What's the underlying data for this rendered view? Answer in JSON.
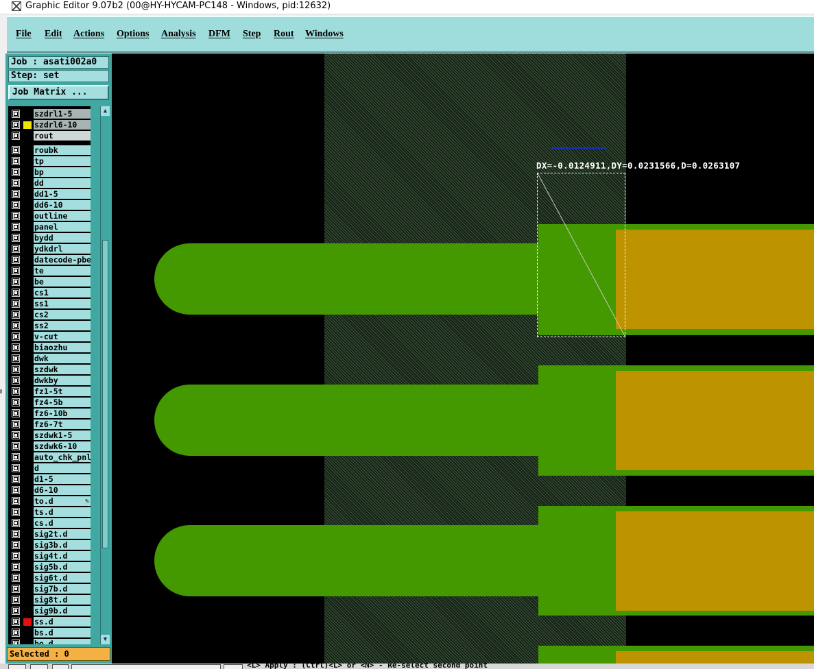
{
  "window": {
    "title": "Graphic Editor 9.07b2 (00@HY-HYCAM-PC148 - Windows, pid:12632)"
  },
  "menu": [
    "File",
    "Edit",
    "Actions",
    "Options",
    "Analysis",
    "DFM",
    "Step",
    "Rout",
    "Windows"
  ],
  "job": {
    "job_label": "Job : asati002a0",
    "step_label": "Step: set",
    "matrix_button": "Job Matrix ..."
  },
  "layers_top": [
    {
      "name": "szdrl1-5",
      "swatch": "",
      "style": "gray"
    },
    {
      "name": "szdrl6-10",
      "swatch": "#f2e200",
      "style": "gray"
    },
    {
      "name": "rout",
      "swatch": "",
      "style": "active"
    }
  ],
  "layers": [
    {
      "name": "roubk",
      "swatch": ""
    },
    {
      "name": "tp",
      "swatch": ""
    },
    {
      "name": "bp",
      "swatch": ""
    },
    {
      "name": "dd",
      "swatch": ""
    },
    {
      "name": "dd1-5",
      "swatch": ""
    },
    {
      "name": "dd6-10",
      "swatch": ""
    },
    {
      "name": "outline",
      "swatch": ""
    },
    {
      "name": "panel",
      "swatch": ""
    },
    {
      "name": "bydd",
      "swatch": ""
    },
    {
      "name": "ydkdrl",
      "swatch": ""
    },
    {
      "name": "datecode-pbe",
      "swatch": ""
    },
    {
      "name": "te",
      "swatch": ""
    },
    {
      "name": "be",
      "swatch": ""
    },
    {
      "name": "cs1",
      "swatch": ""
    },
    {
      "name": "ss1",
      "swatch": ""
    },
    {
      "name": "cs2",
      "swatch": ""
    },
    {
      "name": "ss2",
      "swatch": ""
    },
    {
      "name": "v-cut",
      "swatch": ""
    },
    {
      "name": "biaozhu",
      "swatch": ""
    },
    {
      "name": "dwk",
      "swatch": ""
    },
    {
      "name": "szdwk",
      "swatch": ""
    },
    {
      "name": "dwkby",
      "swatch": ""
    },
    {
      "name": "fz1-5t",
      "swatch": ""
    },
    {
      "name": "fz4-5b",
      "swatch": ""
    },
    {
      "name": "fz6-10b",
      "swatch": ""
    },
    {
      "name": "fz6-7t",
      "swatch": ""
    },
    {
      "name": "szdwk1-5",
      "swatch": ""
    },
    {
      "name": "szdwk6-10",
      "swatch": ""
    },
    {
      "name": "auto_chk_pnl",
      "swatch": ""
    },
    {
      "name": "d",
      "swatch": ""
    },
    {
      "name": "d1-5",
      "swatch": ""
    },
    {
      "name": "d6-10",
      "swatch": ""
    },
    {
      "name": "to.d",
      "swatch": "",
      "pointer": true
    },
    {
      "name": "ts.d",
      "swatch": ""
    },
    {
      "name": "cs.d",
      "swatch": ""
    },
    {
      "name": "sig2t.d",
      "swatch": ""
    },
    {
      "name": "sig3b.d",
      "swatch": ""
    },
    {
      "name": "sig4t.d",
      "swatch": ""
    },
    {
      "name": "sig5b.d",
      "swatch": ""
    },
    {
      "name": "sig6t.d",
      "swatch": ""
    },
    {
      "name": "sig7b.d",
      "swatch": ""
    },
    {
      "name": "sig8t.d",
      "swatch": ""
    },
    {
      "name": "sig9b.d",
      "swatch": ""
    },
    {
      "name": "ss.d",
      "swatch": "#e41010"
    },
    {
      "name": "bs.d",
      "swatch": ""
    },
    {
      "name": "bo.d",
      "swatch": ""
    }
  ],
  "selected": "Selected : 0",
  "measurement": {
    "readout": "DX=-0.0124911,DY=0.0231566,D=0.0263107"
  },
  "status": {
    "message": "<L>  Apply  : (Ctrl)<L> or <N> - Re-select second point"
  },
  "colors": {
    "panel_cyan": "#a4dede",
    "pad_green": "#449800",
    "gold_finger": "#bd9400",
    "selected_orange": "#f4b042"
  },
  "icons": {
    "app": "x-window-icon",
    "scroll_up": "triangle-up-icon",
    "scroll_down": "triangle-down-icon",
    "pointer": "pencil-pointer-icon"
  }
}
